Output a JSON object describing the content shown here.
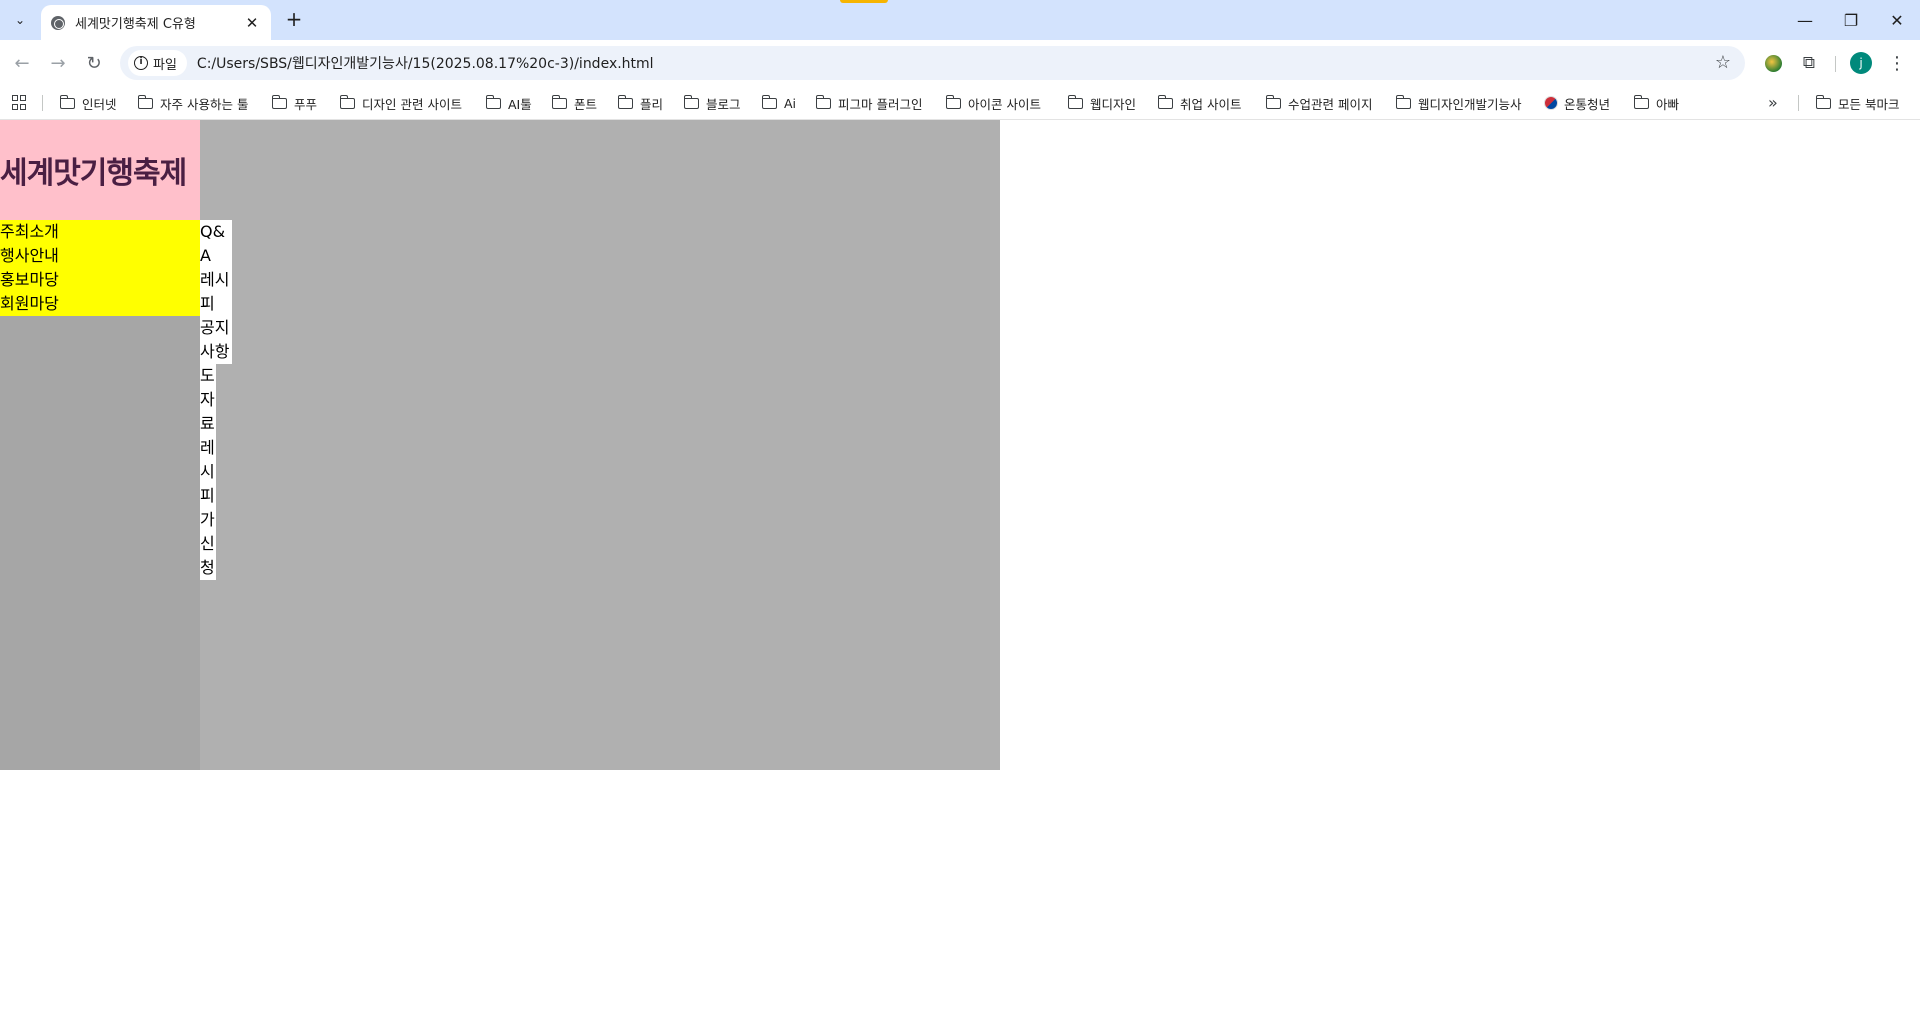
{
  "browser": {
    "tab_title": "세계맛기행축제 C유형",
    "site_chip": "파일",
    "url": "C:/Users/SBS/웹디자인개발기능사/15(2025.08.17%20c-3)/index.html",
    "profile_initial": "j"
  },
  "bookmarks": {
    "items": [
      "인터넷",
      "자주 사용하는 툴",
      "푸푸",
      "디자인 관련 사이트",
      "AI툴",
      "폰트",
      "플리",
      "블로그",
      "Ai",
      "피그마 플러그인",
      "아이콘 사이트",
      "웹디자인",
      "취업 사이트",
      "수업관련 페이지",
      "웹디자인개발기능사",
      "온통청년",
      "아빠"
    ],
    "all_bookmarks": "모든 북마크"
  },
  "page": {
    "logo": "세계맛기행축제",
    "menu": [
      "주최소개",
      "행사안내",
      "홍보마당",
      "회원마당"
    ],
    "submenu": [
      "Q&A",
      "레시피",
      "공지사항",
      "도자료",
      "레시피가신청"
    ]
  }
}
